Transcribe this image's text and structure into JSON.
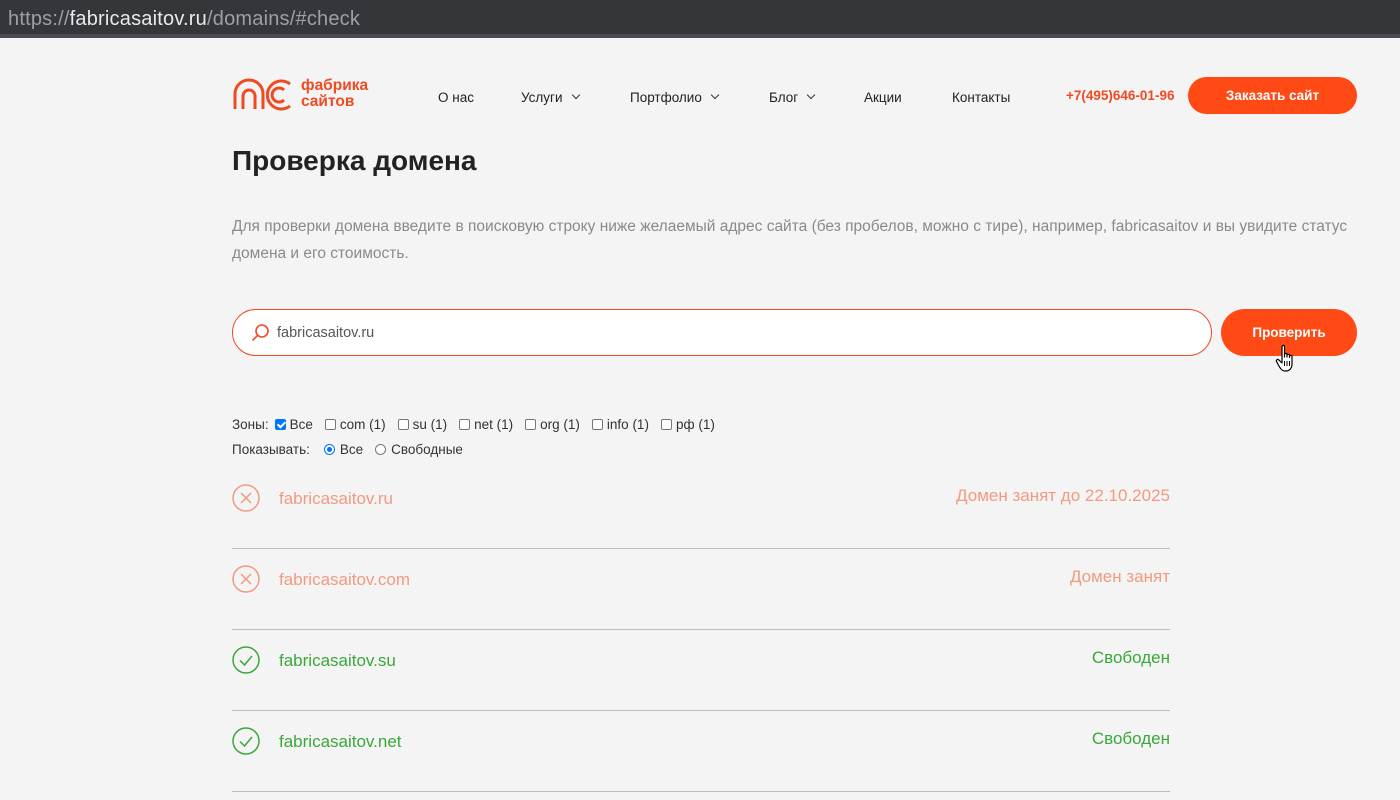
{
  "browser": {
    "url_scheme": "https://",
    "url_host": "fabricasaitov.ru",
    "url_path": "/domains/#check"
  },
  "header": {
    "logo_line1": "фабрика",
    "logo_line2": "сайтов",
    "nav": [
      {
        "label": "О нас",
        "has_dropdown": false
      },
      {
        "label": "Услуги",
        "has_dropdown": true
      },
      {
        "label": "Портфолио",
        "has_dropdown": true
      },
      {
        "label": "Блог",
        "has_dropdown": true
      },
      {
        "label": "Акции",
        "has_dropdown": false
      },
      {
        "label": "Контакты",
        "has_dropdown": false
      }
    ],
    "phone": "+7(495)646-01-96",
    "order_button": "Заказать сайт"
  },
  "page": {
    "title": "Проверка домена",
    "intro": "Для проверки домена введите в поисковую строку ниже желаемый адрес сайта (без пробелов, можно с тире), например, fabricasaitov и вы увидите статус домена и его стоимость."
  },
  "search": {
    "value": "fabricasaitov.ru",
    "button": "Проверить"
  },
  "filters": {
    "zones_label": "Зоны:",
    "zones": [
      {
        "label": "Все",
        "checked": true
      },
      {
        "label": "com (1)",
        "checked": false
      },
      {
        "label": "su (1)",
        "checked": false
      },
      {
        "label": "net (1)",
        "checked": false
      },
      {
        "label": "org (1)",
        "checked": false
      },
      {
        "label": "info (1)",
        "checked": false
      },
      {
        "label": "рф (1)",
        "checked": false
      }
    ],
    "show_label": "Показывать:",
    "show_options": [
      {
        "label": "Все",
        "selected": true
      },
      {
        "label": "Свободные",
        "selected": false
      }
    ]
  },
  "results": [
    {
      "domain": "fabricasaitov.ru",
      "status": "Домен занят до 22.10.2025",
      "state": "taken"
    },
    {
      "domain": "fabricasaitov.com",
      "status": "Домен занят",
      "state": "taken"
    },
    {
      "domain": "fabricasaitov.su",
      "status": "Свободен",
      "state": "free"
    },
    {
      "domain": "fabricasaitov.net",
      "status": "Свободен",
      "state": "free"
    }
  ],
  "colors": {
    "accent": "#ff4a16",
    "taken": "#f29a80",
    "free": "#3aa83a"
  }
}
